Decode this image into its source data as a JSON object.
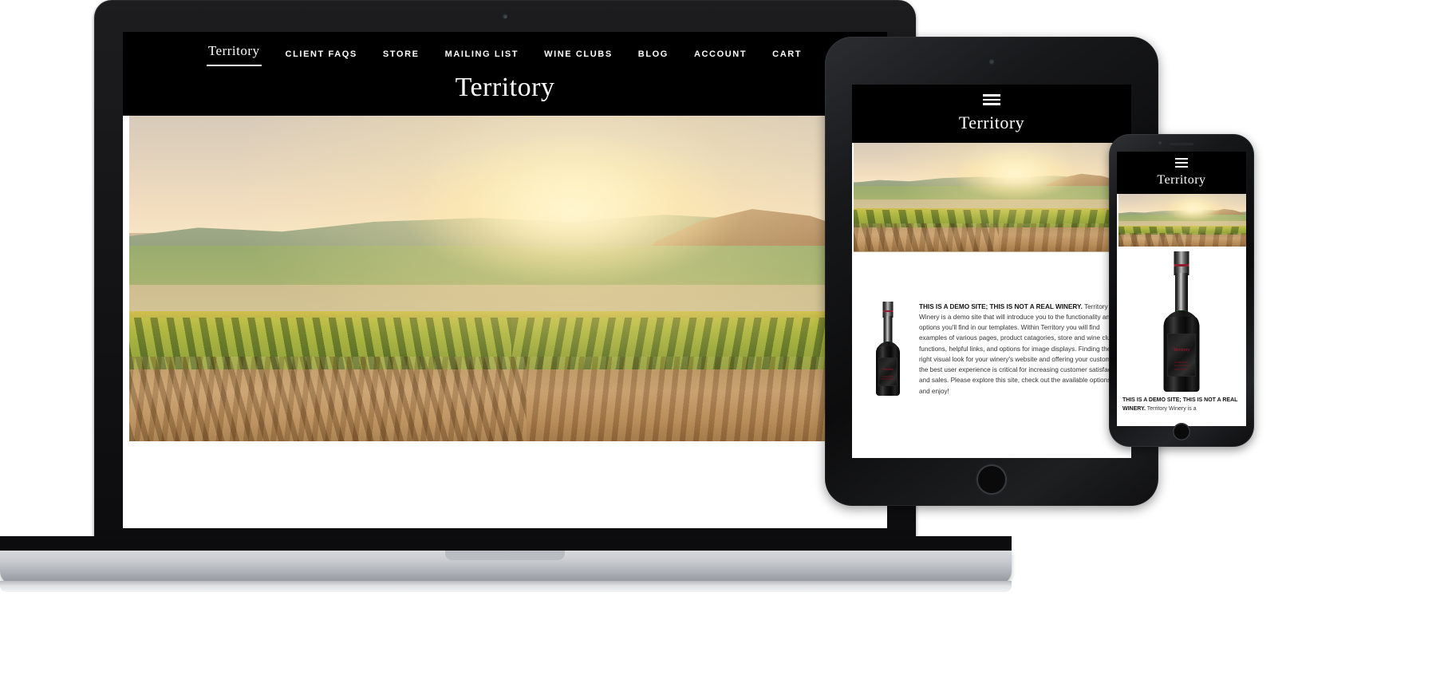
{
  "site": {
    "brand": "Territory",
    "nav": [
      {
        "label": "Territory",
        "active": true
      },
      {
        "label": "CLIENT FAQS",
        "active": false
      },
      {
        "label": "STORE",
        "active": false
      },
      {
        "label": "MAILING LIST",
        "active": false
      },
      {
        "label": "WINE CLUBS",
        "active": false
      },
      {
        "label": "BLOG",
        "active": false
      },
      {
        "label": "ACCOUNT",
        "active": false
      },
      {
        "label": "CART",
        "active": false
      }
    ],
    "hero_alt": "Vineyard rows at sunrise over rolling Tuscan hills",
    "intro": {
      "headline": "THIS IS A DEMO SITE; THIS IS NOT A REAL WINERY",
      "headline_punct": ".",
      "body": "Territory Winery is a demo site that will introduce you to the functionality and options you'll find in our templates. Within Territory you will find examples of various pages, product catagories, store and wine club functions, helpful links, and options for image displays. Finding the right visual look for your winery's website and offering your customers the best user experience is critical for increasing customer satisfaction and sales. Please explore this site, check out the available options, and enjoy!",
      "body_phone_excerpt": "Territory Winery is a"
    },
    "bottle": {
      "label_name": "Territory",
      "label_varietal": "CABERNET SAUVIGNON",
      "label_appellation": "NAPA VALLEY"
    },
    "menu_icon": "hamburger-menu-icon"
  },
  "devices": {
    "laptop": {
      "name": "laptop-mockup",
      "camera_icon": "webcam-icon"
    },
    "tablet": {
      "name": "tablet-mockup",
      "camera_icon": "front-camera-icon",
      "home_button": "home-button"
    },
    "phone": {
      "name": "phone-mockup",
      "camera_icon": "front-camera-icon",
      "home_button": "home-button"
    }
  },
  "colors": {
    "header_bg": "#000000",
    "page_bg": "#ffffff",
    "text": "#333333",
    "heading": "#111111",
    "label_red": "#b3132a"
  }
}
